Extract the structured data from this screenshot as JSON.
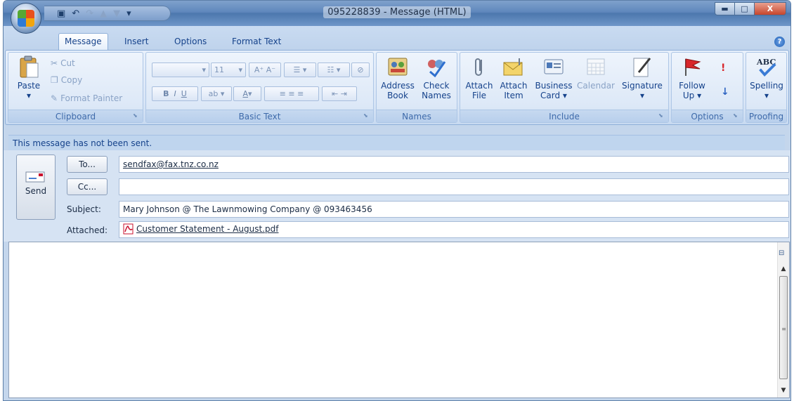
{
  "window": {
    "title": "095228839 - Message (HTML)"
  },
  "quick_access": {
    "save_icon": "save-icon",
    "undo_icon": "undo-icon",
    "redo_icon": "redo-icon",
    "up_icon": "up-arrow-icon",
    "down_icon": "down-arrow-icon",
    "customize_icon": "customize-qat-icon"
  },
  "window_buttons": {
    "minimize": "▬",
    "maximize": "□",
    "close": "X"
  },
  "tabs": [
    {
      "label": "Message"
    },
    {
      "label": "Insert"
    },
    {
      "label": "Options"
    },
    {
      "label": "Format Text"
    }
  ],
  "ribbon": {
    "clipboard": {
      "label": "Clipboard",
      "paste": "Paste",
      "cut": "Cut",
      "copy": "Copy",
      "format_painter": "Format Painter"
    },
    "basic_text": {
      "label": "Basic Text",
      "font_name": "",
      "font_size": "11"
    },
    "names": {
      "label": "Names",
      "address_book_1": "Address",
      "address_book_2": "Book",
      "check_names_1": "Check",
      "check_names_2": "Names"
    },
    "include": {
      "label": "Include",
      "attach_file_1": "Attach",
      "attach_file_2": "File",
      "attach_item_1": "Attach",
      "attach_item_2": "Item",
      "business_card_1": "Business",
      "business_card_2": "Card ▾",
      "calendar": "Calendar",
      "signature": "Signature"
    },
    "options": {
      "label": "Options",
      "follow_up_1": "Follow",
      "follow_up_2": "Up ▾"
    },
    "proofing": {
      "label": "Proofing",
      "spelling": "Spelling"
    }
  },
  "info_bar": "This message has not been sent.",
  "form": {
    "send": "Send",
    "to_button": "To...",
    "to_value": "sendfax@fax.tnz.co.nz",
    "cc_button": "Cc...",
    "cc_value": "",
    "subject_label": "Subject:",
    "subject_value": "Mary Johnson @ The Lawnmowing Company @ 093463456",
    "attached_label": "Attached:",
    "attachment_name": "Customer Statement - August.pdf"
  },
  "colors": {
    "ribbon_text": "#15428b",
    "frame": "#c4d6ec",
    "pdf_red": "#c8102e"
  }
}
